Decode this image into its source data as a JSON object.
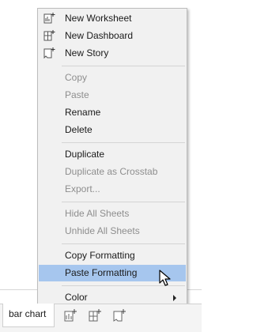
{
  "menu": {
    "items": [
      {
        "label": "New Worksheet",
        "enabled": true,
        "icon": "new-worksheet-icon"
      },
      {
        "label": "New Dashboard",
        "enabled": true,
        "icon": "new-dashboard-icon"
      },
      {
        "label": "New Story",
        "enabled": true,
        "icon": "new-story-icon"
      },
      {
        "label": "Copy",
        "enabled": false
      },
      {
        "label": "Paste",
        "enabled": false
      },
      {
        "label": "Rename",
        "enabled": true
      },
      {
        "label": "Delete",
        "enabled": true
      },
      {
        "label": "Duplicate",
        "enabled": true
      },
      {
        "label": "Duplicate as Crosstab",
        "enabled": false
      },
      {
        "label": "Export...",
        "enabled": false
      },
      {
        "label": "Hide All Sheets",
        "enabled": false
      },
      {
        "label": "Unhide All Sheets",
        "enabled": false
      },
      {
        "label": "Copy Formatting",
        "enabled": true
      },
      {
        "label": "Paste Formatting",
        "enabled": true,
        "highlighted": true
      },
      {
        "label": "Color",
        "enabled": true,
        "submenu": true
      }
    ]
  },
  "tabs": {
    "sheet_tab_label": "bar chart",
    "buttons": [
      "new-worksheet-icon",
      "new-dashboard-icon",
      "new-story-icon"
    ]
  },
  "colors": {
    "menu_bg": "#f1f1f1",
    "highlight": "#a6c6ee",
    "disabled_text": "#8e8e8e"
  }
}
